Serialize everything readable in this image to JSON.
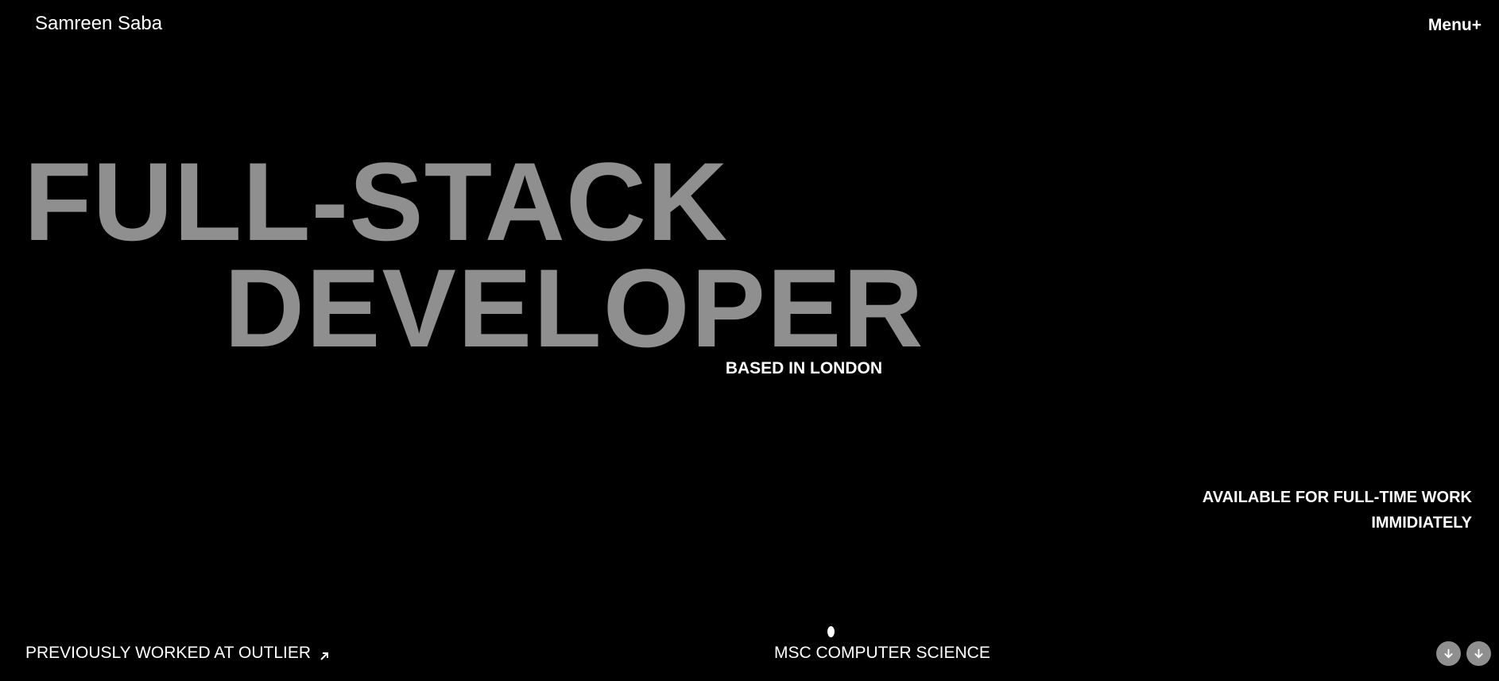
{
  "header": {
    "brand": "Samreen Saba",
    "menu_label": "Menu+"
  },
  "hero": {
    "line1": "FULL-STACK",
    "line2": "DEVELOPER",
    "location": "BASED IN LONDON"
  },
  "availability": {
    "line1": "AVAILABLE FOR FULL-TIME WORK",
    "line2": "IMMIDIATELY"
  },
  "footer": {
    "previous_work": "PREVIOUSLY WORKED AT OUTLIER",
    "previous_work_icon": "arrow-up-right-icon",
    "education": "MSC COMPUTER SCIENCE",
    "scroll_icons": [
      "arrow-down-icon",
      "arrow-down-icon"
    ]
  },
  "colors": {
    "background": "#000000",
    "text": "#ffffff",
    "hero_text": "#8f8f8f",
    "button_bg": "#8f8f8f"
  }
}
